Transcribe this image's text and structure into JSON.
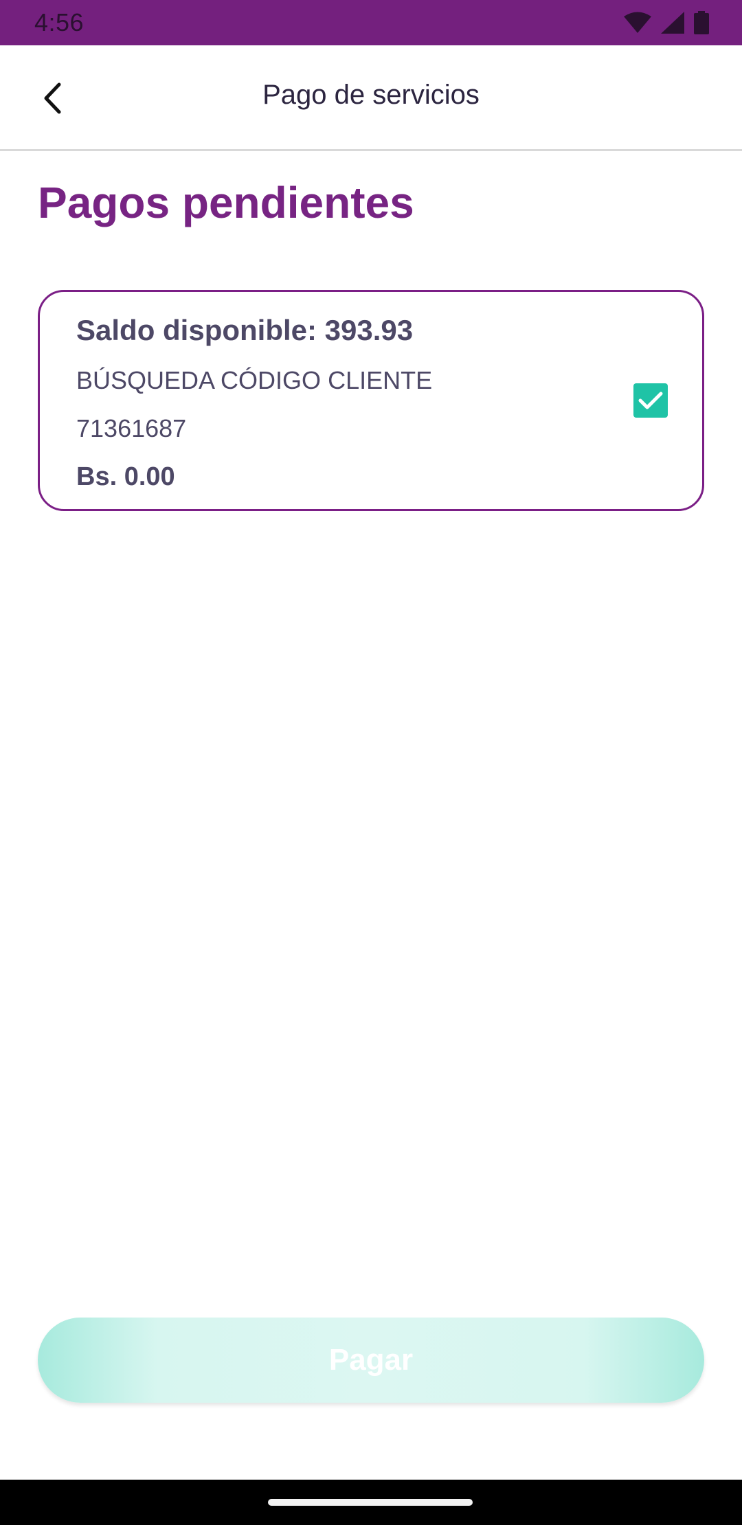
{
  "status_bar": {
    "time": "4:56",
    "icons": [
      "wifi-icon",
      "signal-icon",
      "battery-icon"
    ],
    "background": "#74207e"
  },
  "app_bar": {
    "title": "Pago de servicios",
    "back_icon": "chevron-left-icon"
  },
  "main": {
    "title": "Pagos pendientes",
    "payments": [
      {
        "balance": "Saldo disponible: 393.93",
        "service": "BÚSQUEDA CÓDIGO CLIENTE",
        "code": "71361687",
        "amount": "Bs. 0.00",
        "selected": true
      }
    ]
  },
  "footer": {
    "pay_label": "Pagar"
  },
  "colors": {
    "accent": "#772483",
    "checkbox": "#1fc3a6",
    "button_gradient": "#a7eadd"
  }
}
